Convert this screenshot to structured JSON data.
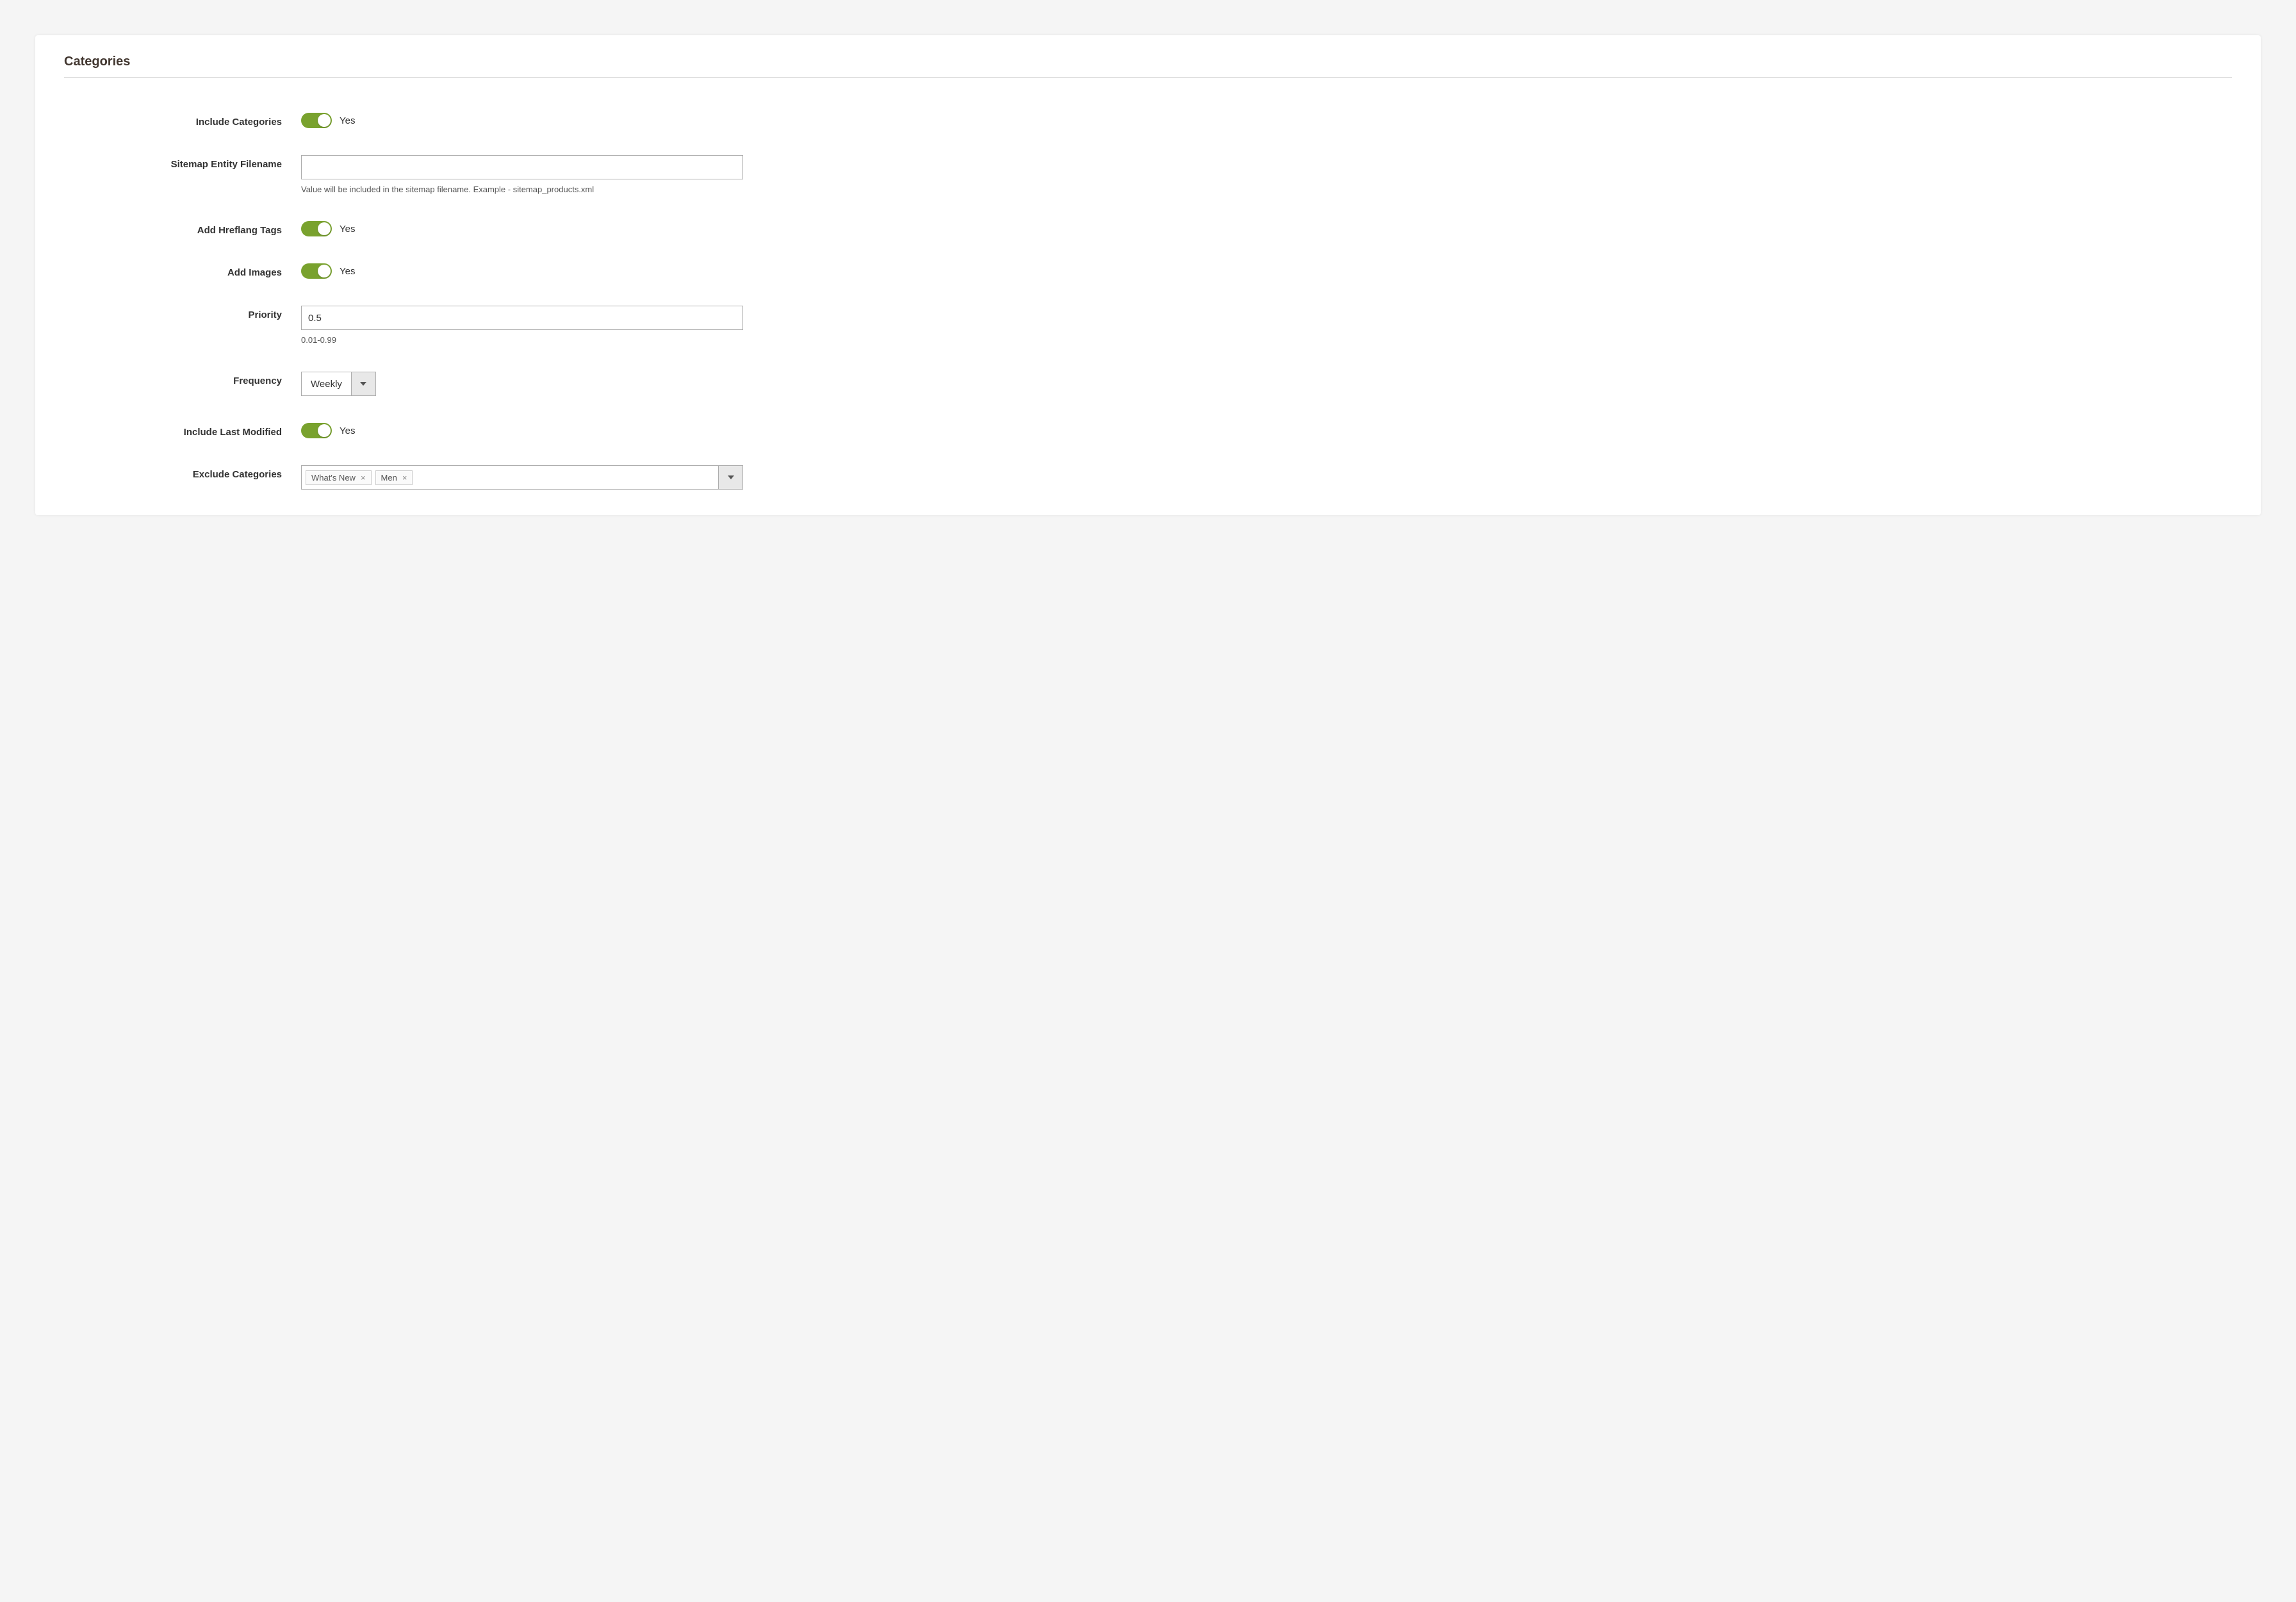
{
  "section": {
    "title": "Categories"
  },
  "fields": {
    "include_categories": {
      "label": "Include Categories",
      "value": "Yes"
    },
    "sitemap_filename": {
      "label": "Sitemap Entity Filename",
      "value": "",
      "note": "Value will be included in the sitemap filename. Example - sitemap_products.xml"
    },
    "hreflang": {
      "label": "Add Hreflang Tags",
      "value": "Yes"
    },
    "add_images": {
      "label": "Add Images",
      "value": "Yes"
    },
    "priority": {
      "label": "Priority",
      "value": "0.5",
      "note": "0.01-0.99"
    },
    "frequency": {
      "label": "Frequency",
      "value": "Weekly"
    },
    "last_modified": {
      "label": "Include Last Modified",
      "value": "Yes"
    },
    "exclude": {
      "label": "Exclude Categories",
      "tags": [
        "What's New",
        "Men"
      ]
    }
  }
}
